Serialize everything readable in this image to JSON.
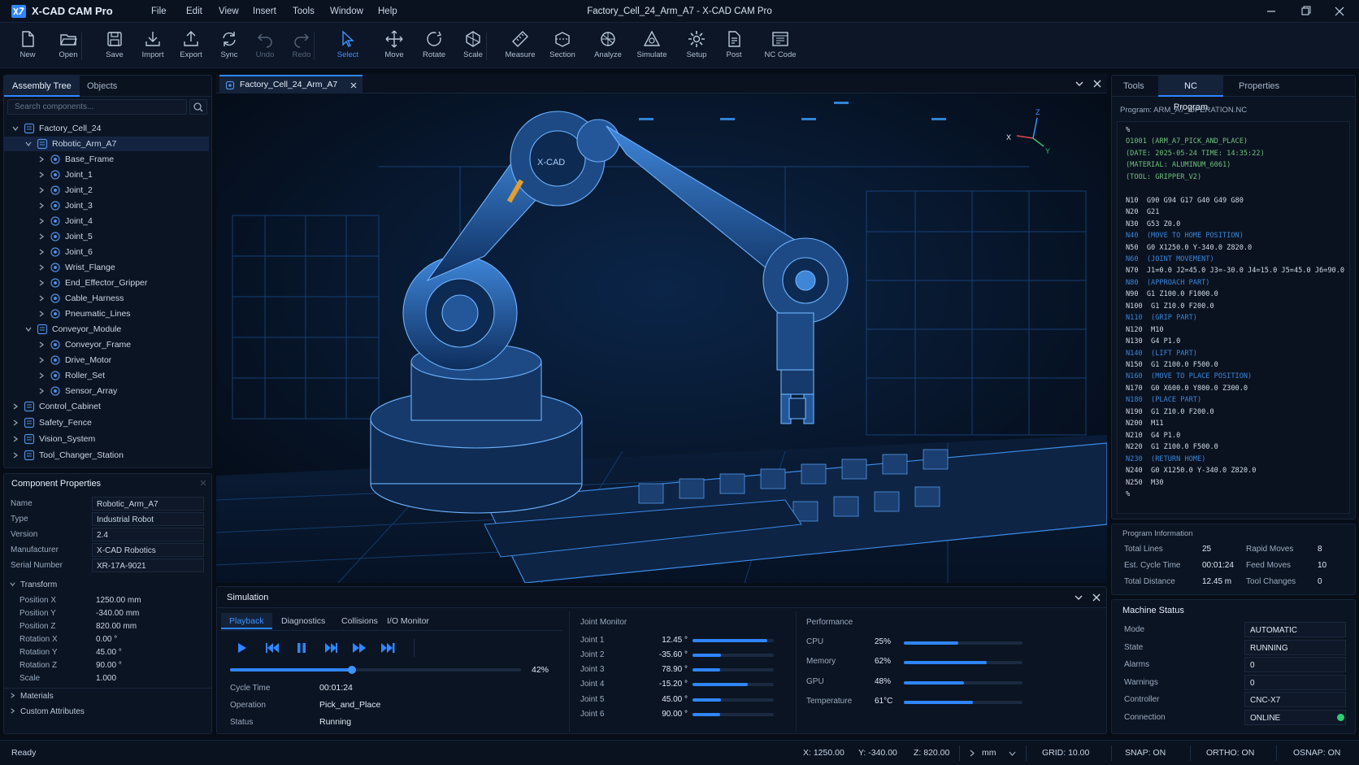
{
  "app": {
    "name": "X-CAD CAM Pro",
    "window_title": "Factory_Cell_24_Arm_A7  -  X-CAD CAM Pro"
  },
  "menu": [
    "File",
    "Edit",
    "View",
    "Insert",
    "Tools",
    "Window",
    "Help"
  ],
  "toolbar": [
    {
      "label": "New",
      "icon": "new-file-icon",
      "state": "normal"
    },
    {
      "label": "Open",
      "icon": "folder-open-icon",
      "state": "normal"
    },
    {
      "label": "Save",
      "icon": "save-icon",
      "state": "normal"
    },
    {
      "label": "Import",
      "icon": "import-icon",
      "state": "normal"
    },
    {
      "label": "Export",
      "icon": "export-icon",
      "state": "normal"
    },
    {
      "label": "Sync",
      "icon": "sync-icon",
      "state": "normal"
    },
    {
      "label": "Undo",
      "icon": "undo-icon",
      "state": "disabled"
    },
    {
      "label": "Redo",
      "icon": "redo-icon",
      "state": "disabled"
    },
    {
      "label": "Select",
      "icon": "cursor-icon",
      "state": "active"
    },
    {
      "label": "Move",
      "icon": "move-icon",
      "state": "normal"
    },
    {
      "label": "Rotate",
      "icon": "rotate-icon",
      "state": "normal"
    },
    {
      "label": "Scale",
      "icon": "scale-icon",
      "state": "normal"
    },
    {
      "label": "Measure",
      "icon": "measure-icon",
      "state": "normal"
    },
    {
      "label": "Section",
      "icon": "section-icon",
      "state": "normal"
    },
    {
      "label": "Analyze",
      "icon": "analyze-icon",
      "state": "normal"
    },
    {
      "label": "Simulate",
      "icon": "simulate-icon",
      "state": "normal"
    },
    {
      "label": "Setup",
      "icon": "gear-icon",
      "state": "normal"
    },
    {
      "label": "Post",
      "icon": "post-icon",
      "state": "normal"
    },
    {
      "label": "NC Code",
      "icon": "nc-code-icon",
      "state": "normal"
    }
  ],
  "left_panel": {
    "tabs": [
      "Assembly Tree",
      "Objects"
    ],
    "search_placeholder": "Search components...",
    "tree": [
      {
        "label": "Factory_Cell_24",
        "depth": 0,
        "expanded": true
      },
      {
        "label": "Robotic_Arm_A7",
        "depth": 1,
        "expanded": true,
        "selected": true
      },
      {
        "label": "Base_Frame",
        "depth": 2
      },
      {
        "label": "Joint_1",
        "depth": 2
      },
      {
        "label": "Joint_2",
        "depth": 2
      },
      {
        "label": "Joint_3",
        "depth": 2
      },
      {
        "label": "Joint_4",
        "depth": 2
      },
      {
        "label": "Joint_5",
        "depth": 2
      },
      {
        "label": "Joint_6",
        "depth": 2
      },
      {
        "label": "Wrist_Flange",
        "depth": 2
      },
      {
        "label": "End_Effector_Gripper",
        "depth": 2
      },
      {
        "label": "Cable_Harness",
        "depth": 2
      },
      {
        "label": "Pneumatic_Lines",
        "depth": 2
      },
      {
        "label": "Conveyor_Module",
        "depth": 1,
        "expanded": true
      },
      {
        "label": "Conveyor_Frame",
        "depth": 2
      },
      {
        "label": "Drive_Motor",
        "depth": 2
      },
      {
        "label": "Roller_Set",
        "depth": 2
      },
      {
        "label": "Sensor_Array",
        "depth": 2
      },
      {
        "label": "Control_Cabinet",
        "depth": 0
      },
      {
        "label": "Safety_Fence",
        "depth": 0
      },
      {
        "label": "Vision_System",
        "depth": 0
      },
      {
        "label": "Tool_Changer_Station",
        "depth": 0
      }
    ]
  },
  "component_properties": {
    "title": "Component Properties",
    "rows": [
      {
        "key": "Name",
        "value": "Robotic_Arm_A7"
      },
      {
        "key": "Type",
        "value": "Industrial Robot"
      },
      {
        "key": "Version",
        "value": "2.4"
      },
      {
        "key": "Manufacturer",
        "value": "X-CAD Robotics"
      },
      {
        "key": "Serial Number",
        "value": "XR-17A-9021"
      }
    ],
    "transform_title": "Transform",
    "transform": [
      {
        "key": "Position X",
        "value": "1250.00 mm"
      },
      {
        "key": "Position Y",
        "value": "-340.00 mm"
      },
      {
        "key": "Position Z",
        "value": "820.00 mm"
      },
      {
        "key": "Rotation X",
        "value": "0.00 °"
      },
      {
        "key": "Rotation Y",
        "value": "45.00 °"
      },
      {
        "key": "Rotation Z",
        "value": "90.00 °"
      },
      {
        "key": "Scale",
        "value": "1.000"
      }
    ],
    "materials": "Materials",
    "custom": "Custom Attributes"
  },
  "document_tab": {
    "label": "Factory_Cell_24_Arm_A7"
  },
  "viewport": {
    "robot_label": "X-CAD",
    "axes": [
      "X",
      "Y",
      "Z"
    ],
    "accent": "#2f86ff"
  },
  "right_panel": {
    "tabs": [
      "Tools",
      "NC Program",
      "Properties"
    ],
    "program_label": "Program: ARM_A7_OPERATION.NC",
    "code": [
      {
        "t": "%",
        "c": "ln"
      },
      {
        "t": "O1001 (ARM_A7_PICK_AND_PLACE)",
        "c": "hdr"
      },
      {
        "t": "(DATE: 2025-05-24 TIME: 14:35:22)",
        "c": "hdr"
      },
      {
        "t": "(MATERIAL: ALUMINUM_6061)",
        "c": "hdr"
      },
      {
        "t": "(TOOL: GRIPPER_V2)",
        "c": "hdr"
      },
      {
        "t": "",
        "c": "ln"
      },
      {
        "t": "N10  G90 G94 G17 G40 G49 G80",
        "c": "ln"
      },
      {
        "t": "N20  G21",
        "c": "ln"
      },
      {
        "t": "N30  G53 Z0.0",
        "c": "ln"
      },
      {
        "t": "N40  (MOVE TO HOME POSITION)",
        "c": "cmt"
      },
      {
        "t": "N50  G0 X1250.0 Y-340.0 Z820.0",
        "c": "ln"
      },
      {
        "t": "N60  (JOINT MOVEMENT)",
        "c": "cmt"
      },
      {
        "t": "N70  J1=0.0 J2=45.0 J3=-30.0 J4=15.0 J5=45.0 J6=90.0",
        "c": "ln"
      },
      {
        "t": "N80  (APPROACH PART)",
        "c": "cmt"
      },
      {
        "t": "N90  G1 Z100.0 F1000.0",
        "c": "ln"
      },
      {
        "t": "N100  G1 Z10.0 F200.0",
        "c": "ln"
      },
      {
        "t": "N110  (GRIP PART)",
        "c": "cmt"
      },
      {
        "t": "N120  M10",
        "c": "ln"
      },
      {
        "t": "N130  G4 P1.0",
        "c": "ln"
      },
      {
        "t": "N140  (LIFT PART)",
        "c": "cmt"
      },
      {
        "t": "N150  G1 Z100.0 F500.0",
        "c": "ln"
      },
      {
        "t": "N160  (MOVE TO PLACE POSITION)",
        "c": "cmt"
      },
      {
        "t": "N170  G0 X600.0 Y800.0 Z300.0",
        "c": "ln"
      },
      {
        "t": "N180  (PLACE PART)",
        "c": "cmt"
      },
      {
        "t": "N190  G1 Z10.0 F200.0",
        "c": "ln"
      },
      {
        "t": "N200  M11",
        "c": "ln"
      },
      {
        "t": "N210  G4 P1.0",
        "c": "ln"
      },
      {
        "t": "N220  G1 Z100.0 F500.0",
        "c": "ln"
      },
      {
        "t": "N230  (RETURN HOME)",
        "c": "cmt"
      },
      {
        "t": "N240  G0 X1250.0 Y-340.0 Z820.0",
        "c": "ln"
      },
      {
        "t": "N250  M30",
        "c": "ln"
      },
      {
        "t": "%",
        "c": "ln"
      }
    ],
    "program_info": {
      "title": "Program Information",
      "left": [
        {
          "key": "Total Lines",
          "value": "25"
        },
        {
          "key": "Est. Cycle Time",
          "value": "00:01:24"
        },
        {
          "key": "Total Distance",
          "value": "12.45 m"
        }
      ],
      "right": [
        {
          "key": "Rapid Moves",
          "value": "8"
        },
        {
          "key": "Feed Moves",
          "value": "10"
        },
        {
          "key": "Tool Changes",
          "value": "0"
        }
      ]
    },
    "machine_status": {
      "title": "Machine Status",
      "rows": [
        {
          "key": "Mode",
          "value": "AUTOMATIC"
        },
        {
          "key": "State",
          "value": "RUNNING"
        },
        {
          "key": "Alarms",
          "value": "0"
        },
        {
          "key": "Warnings",
          "value": "0"
        },
        {
          "key": "Controller",
          "value": "CNC-X7"
        },
        {
          "key": "Connection",
          "value": "ONLINE",
          "indicator": "#2ecc71"
        }
      ]
    }
  },
  "simulation": {
    "title": "Simulation",
    "tabs": [
      "Playback",
      "Diagnostics",
      "Collisions",
      "I/O Monitor"
    ],
    "progress": 0.42,
    "progress_label": "42%",
    "info": [
      {
        "key": "Cycle Time",
        "value": "00:01:24"
      },
      {
        "key": "Operation",
        "value": "Pick_and_Place"
      },
      {
        "key": "Status",
        "value": "Running"
      }
    ],
    "joint_monitor": {
      "title": "Joint Monitor",
      "joints": [
        {
          "name": "Joint 1",
          "value": "12.45 °",
          "level": 0.92
        },
        {
          "name": "Joint 2",
          "value": "-35.60 °",
          "level": 0.35
        },
        {
          "name": "Joint 3",
          "value": "78.90 °",
          "level": 0.34
        },
        {
          "name": "Joint 4",
          "value": "-15.20 °",
          "level": 0.68
        },
        {
          "name": "Joint 5",
          "value": "45.00 °",
          "level": 0.35
        },
        {
          "name": "Joint 6",
          "value": "90.00 °",
          "level": 0.34
        }
      ]
    },
    "performance": {
      "title": "Performance",
      "items": [
        {
          "name": "CPU",
          "value": "25%",
          "level": 0.46
        },
        {
          "name": "Memory",
          "value": "62%",
          "level": 0.7
        },
        {
          "name": "GPU",
          "value": "48%",
          "level": 0.51
        },
        {
          "name": "Temperature",
          "value": "61°C",
          "level": 0.58
        }
      ]
    }
  },
  "statusbar": {
    "left": "Ready",
    "x": "X: 1250.00",
    "y": "Y: -340.00",
    "z": "Z: 820.00",
    "units": "mm",
    "grid": "GRID: 10.00",
    "snap": "SNAP: ON",
    "ortho": "ORTHO: ON",
    "osnap": "OSNAP: ON"
  }
}
